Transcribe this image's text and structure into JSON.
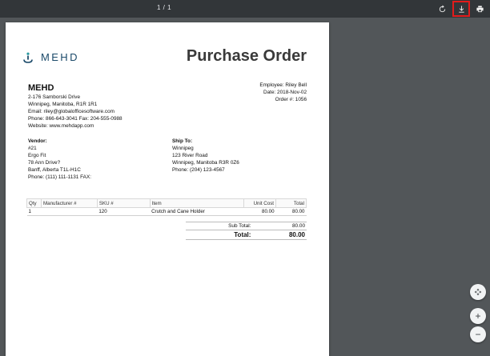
{
  "toolbar": {
    "page_counter": "1 / 1",
    "icons": {
      "rotate": "rotate-icon",
      "download": "download-icon",
      "print": "print-icon"
    }
  },
  "document": {
    "logo_text": "MEHD",
    "title": "Purchase Order",
    "company": {
      "name": "MEHD",
      "address1": "2-176 Samborski Drive",
      "address2": "Winnipeg, Manitoba, R1R 1R1",
      "email": "Email: riley@globalofficesoftware.com",
      "phone": "Phone: 866-643-3041  Fax: 204-555-0988",
      "website": "Website: www.mehdapp.com"
    },
    "meta": {
      "employee": "Employee: Riley Bell",
      "date": "Date: 2018-Nov-02",
      "order": "Order #: 1056"
    },
    "vendor": {
      "label": "Vendor:",
      "line1": "#21",
      "line2": "Ergo Fit",
      "line3": "78 Ann Drive?",
      "line4": "Banff, Alberta  T1L-H1C",
      "line5": "Phone: (111) 111-1131  FAX:"
    },
    "ship_to": {
      "label": "Ship To:",
      "line1": "Winnipeg",
      "line2": "123 River Road",
      "line3": "Winnipeg, Manitoba R3R 0Z6",
      "line4": "Phone: (204) 123-4567"
    },
    "table": {
      "headers": [
        "Qty",
        "Manufacturer #",
        "SKU #",
        "Item",
        "Unit Cost",
        "Total"
      ],
      "rows": [
        [
          "1",
          "",
          "120",
          "Crutch and Cane Holder",
          "80.00",
          "80.00"
        ]
      ]
    },
    "totals": {
      "sub_label": "Sub Total:",
      "sub_value": "80.00",
      "total_label": "Total:",
      "total_value": "80.00"
    }
  },
  "zoom_controls": {
    "fit": "fit-to-page-icon",
    "zoom_in": "+",
    "zoom_out": "−"
  }
}
